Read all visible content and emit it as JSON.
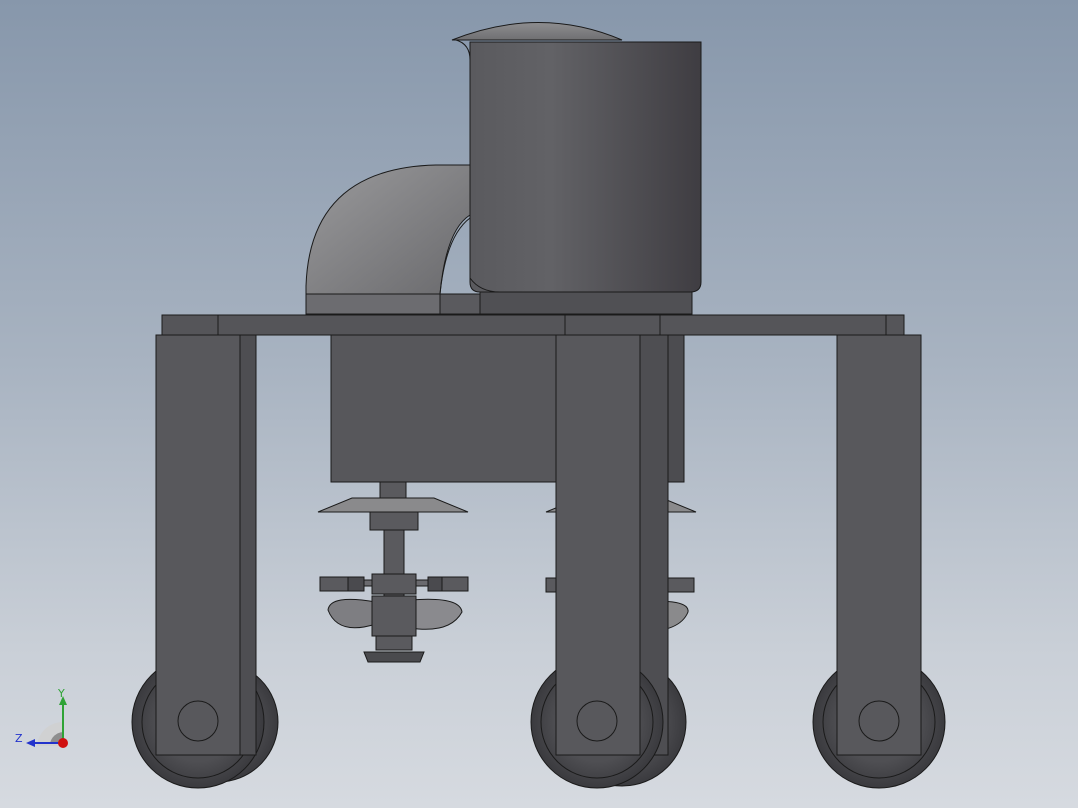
{
  "colors": {
    "background_top": "#8797ab",
    "background_bottom": "#d6dae0",
    "part_dark": "#4a4a4e",
    "part_mid": "#5c5c60",
    "part_light": "#8a8a8c",
    "edge": "#1a1a1a",
    "axis_y": "#2fa336",
    "axis_z": "#2233cc",
    "axis_x": "#d01010"
  },
  "triad": {
    "y_label": "Y",
    "z_label": "Z"
  }
}
